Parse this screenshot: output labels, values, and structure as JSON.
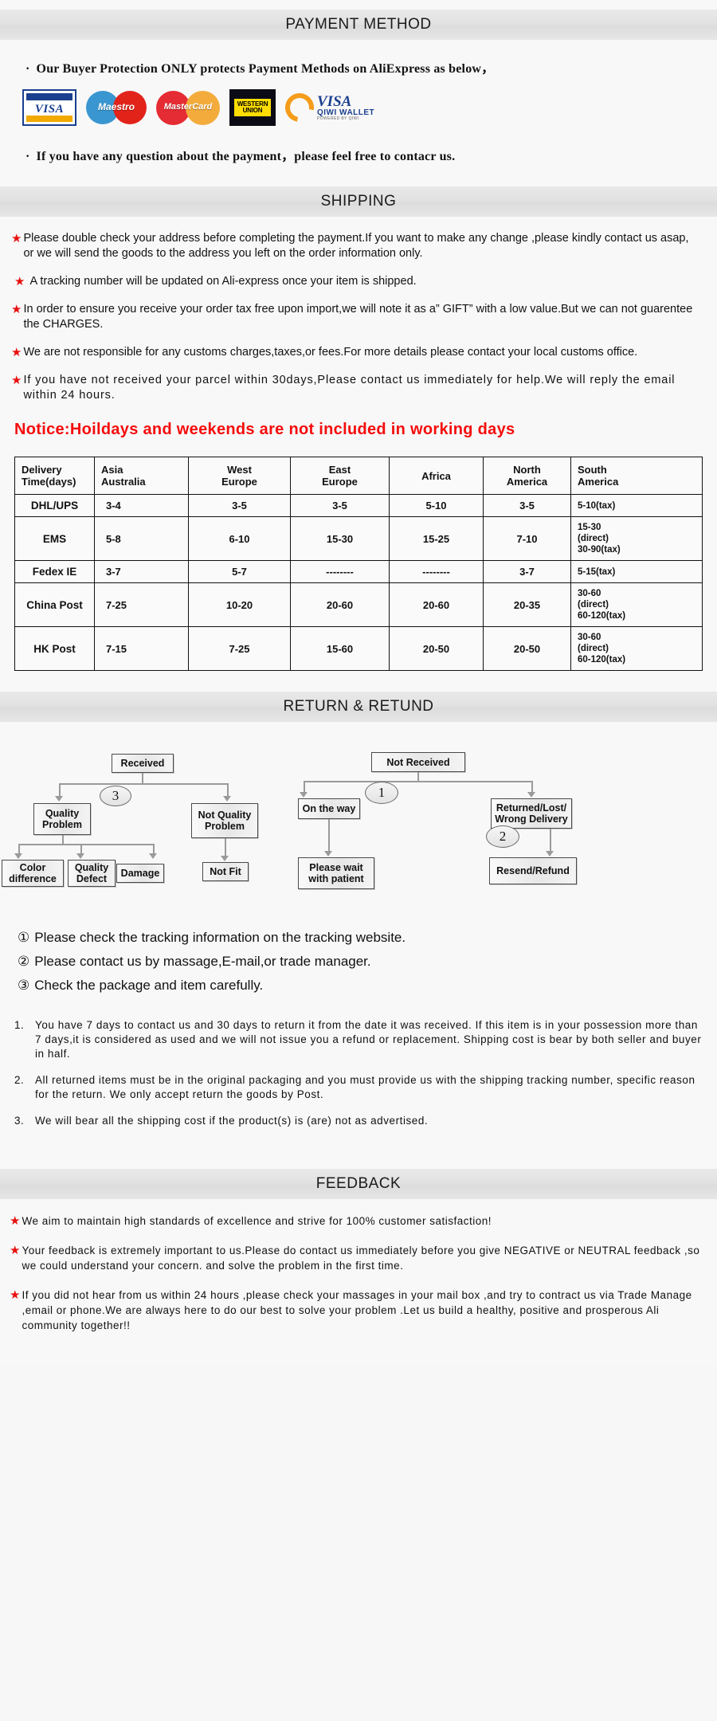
{
  "sections": {
    "payment_title": "PAYMENT METHOD",
    "shipping_title": "SHIPPING",
    "return_title": "RETURN & RETUND",
    "feedback_title": "FEEDBACK"
  },
  "payment": {
    "bullet_dot": "·",
    "line1": "Our Buyer Protection ONLY protects Payment Methods on AliExpress as below，",
    "line2": "If you have any question about the payment，please feel free to contacr us.",
    "logos": [
      {
        "name": "visa-logo",
        "text": "VISA"
      },
      {
        "name": "maestro-logo",
        "text": "Maestro"
      },
      {
        "name": "mastercard-logo",
        "text": "MasterCard"
      },
      {
        "name": "western-union-logo",
        "line1": "WESTERN",
        "line2": "UNION"
      },
      {
        "name": "qiwi-wallet-logo",
        "text": "VISA",
        "sub": "QIWI WALLET",
        "fine": "POWERED BY QIWI"
      }
    ]
  },
  "shipping": {
    "star": "★",
    "bullets": [
      "Please double check your address before completing the payment.If you want to make any change ,please kindly contact us asap, or we will send the goods to the address you left on the order information only.",
      "A tracking number will be updated on Ali-express once your item is shipped.",
      "In order to ensure you receive your order tax free upon import,we will note it as a” GIFT” with a low value.But we can not guarentee the CHARGES.",
      "We are not responsible for any customs charges,taxes,or fees.For more details please contact your local customs office.",
      "If you have not received your parcel within 30days,Please contact us immediately for help.We will reply the email within 24 hours."
    ],
    "notice": "Notice:Hoildays and weekends are not included in working days"
  },
  "chart_data": {
    "type": "table",
    "title": "Delivery Time(days)",
    "columns": [
      "Delivery Time(days)",
      "Asia Australia",
      "West Europe",
      "East Europe",
      "Africa",
      "North America",
      "South America"
    ],
    "rows": [
      {
        "method": "DHL/UPS",
        "cells": [
          "3-4",
          "3-5",
          "3-5",
          "5-10",
          "3-5",
          "5-10(tax)"
        ]
      },
      {
        "method": "EMS",
        "cells": [
          "5-8",
          "6-10",
          "15-30",
          "15-25",
          "7-10",
          "15-30 (direct) 30-90(tax)"
        ]
      },
      {
        "method": "Fedex IE",
        "cells": [
          "3-7",
          "5-7",
          "--------",
          "--------",
          "3-7",
          "5-15(tax)"
        ]
      },
      {
        "method": "China Post",
        "cells": [
          "7-25",
          "10-20",
          "20-60",
          "20-60",
          "20-35",
          "30-60 (direct) 60-120(tax)"
        ]
      },
      {
        "method": "HK Post",
        "cells": [
          "7-15",
          "7-25",
          "15-60",
          "20-50",
          "20-50",
          "30-60 (direct) 60-120(tax)"
        ]
      }
    ]
  },
  "table": {
    "head": [
      "Delivery\nTime(days)",
      "Asia\nAustralia",
      "West\nEurope",
      "East\nEurope",
      "Africa",
      "North\nAmerica",
      "South\nAmerica"
    ],
    "head_parts": [
      {
        "l1": "Delivery",
        "l2": "Time(days)"
      },
      {
        "l1": "Asia",
        "l2": "Australia"
      },
      {
        "l1": "West",
        "l2": "Europe"
      },
      {
        "l1": "East",
        "l2": "Europe"
      },
      {
        "l1": "Africa",
        "l2": ""
      },
      {
        "l1": "North",
        "l2": "America"
      },
      {
        "l1": "South",
        "l2": "America"
      }
    ],
    "rows": [
      {
        "m": "DHL/UPS",
        "a": "3-4",
        "we": "3-5",
        "ee": "3-5",
        "af": "5-10",
        "na": "3-5",
        "sa": "5-10(tax)",
        "sa_multi": false
      },
      {
        "m": "EMS",
        "a": "5-8",
        "we": "6-10",
        "ee": "15-30",
        "af": "15-25",
        "na": "7-10",
        "sa1": "15-30",
        "sa2": "(direct)",
        "sa3": "30-90(tax)",
        "sa_multi": true
      },
      {
        "m": "Fedex IE",
        "a": "3-7",
        "we": "5-7",
        "ee": "--------",
        "af": "--------",
        "na": "3-7",
        "sa": "5-15(tax)",
        "sa_multi": false
      },
      {
        "m": "China Post",
        "a": "7-25",
        "we": "10-20",
        "ee": "20-60",
        "af": "20-60",
        "na": "20-35",
        "sa1": "30-60",
        "sa2": "(direct)",
        "sa3": "60-120(tax)",
        "sa_multi": true
      },
      {
        "m": "HK Post",
        "a": "7-15",
        "we": "7-25",
        "ee": "15-60",
        "af": "20-50",
        "na": "20-50",
        "sa1": "30-60",
        "sa2": "(direct)",
        "sa3": "60-120(tax)",
        "sa_multi": true
      }
    ]
  },
  "flow": {
    "left": {
      "root": "Received",
      "badge": "3",
      "branch_a": "Quality\nProblem",
      "branch_a_l1": "Quality",
      "branch_a_l2": "Problem",
      "branch_b_l1": "Not Quality",
      "branch_b_l2": "Problem",
      "leaf1_l1": "Color",
      "leaf1_l2": "difference",
      "leaf2_l1": "Quality",
      "leaf2_l2": "Defect",
      "leaf3": "Damage",
      "leaf4": "Not Fit"
    },
    "right": {
      "root": "Not  Received",
      "badge1": "1",
      "badge2": "2",
      "branch_a": "On the way",
      "branch_b_l1": "Returned/Lost/",
      "branch_b_l2": "Wrong Delivery",
      "leaf1_l1": "Please wait",
      "leaf1_l2": "with patient",
      "leaf2": "Resend/Refund"
    }
  },
  "numbered": [
    {
      "num": "①",
      "text": "Please check the tracking information on the tracking website."
    },
    {
      "num": "②",
      "text": "Please contact us by  massage,E-mail,or trade manager."
    },
    {
      "num": "③",
      "text": "Check the package and item carefully."
    }
  ],
  "policy": [
    {
      "num": "1.",
      "text": "You have 7 days to contact us and 30 days to return it from the date it was received. If this item is in your possession more than 7 days,it is considered as used and we will not issue you a refund or replacement. Shipping cost is bear by both seller and buyer in half."
    },
    {
      "num": "2.",
      "text": "All returned items must be in the original packaging and you must provide us with the shipping tracking number, specific reason for the return. We only accept return the goods by Post."
    },
    {
      "num": "3.",
      "text": "We will bear all the shipping cost if the product(s) is (are) not as advertised."
    }
  ],
  "feedback": {
    "star": "★",
    "bullets": [
      "We aim to maintain high standards of excellence and strive  for 100% customer satisfaction!",
      "Your feedback is extremely important to us.Please do contact us immediately before you give NEGATIVE or NEUTRAL feedback ,so  we could understand your concern. and solve the problem in the first time.",
      "If you did not hear from us within 24 hours ,please check your massages in your mail box ,and try to contract us via Trade Manage ,email or phone.We are always here to do our best to solve your problem .Let us build a healthy, positive and prosperous Ali community together!!"
    ]
  },
  "colors": {
    "star_red": "#e8100f",
    "notice_red": "#f50c0c",
    "bar_gray": "#e2e2e2"
  }
}
